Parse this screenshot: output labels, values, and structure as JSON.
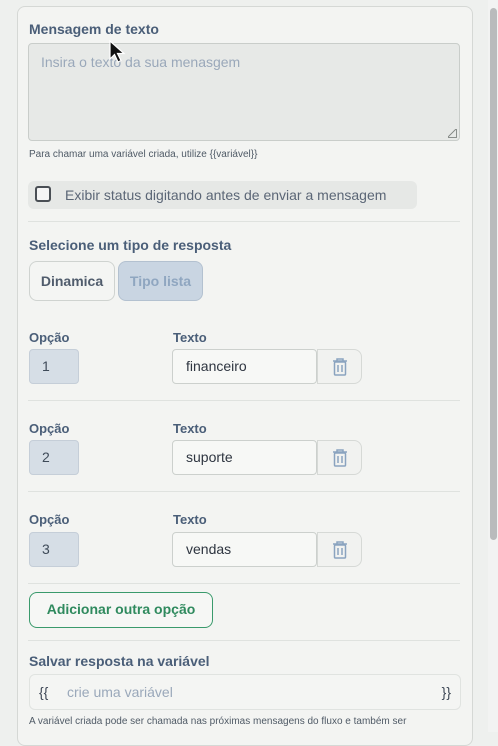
{
  "message_section": {
    "title": "Mensagem de texto",
    "placeholder": "Insira o texto da sua menasgem",
    "hint": "Para chamar uma variável criada, utilize {{variável}}"
  },
  "typing_status": {
    "label": "Exibir status digitando antes de enviar a mensagem",
    "checked": false
  },
  "response_type": {
    "title": "Selecione um tipo de resposta",
    "options": [
      "Dinamica",
      "Tipo lista"
    ],
    "selected": "Tipo lista"
  },
  "options": {
    "col_option": "Opção",
    "col_text": "Texto",
    "rows": [
      {
        "number": "1",
        "text": "financeiro"
      },
      {
        "number": "2",
        "text": "suporte"
      },
      {
        "number": "3",
        "text": "vendas"
      }
    ]
  },
  "add_option_label": "Adicionar outra opção",
  "save_variable": {
    "title": "Salvar resposta na variável",
    "left_brace": "{{",
    "right_brace": "}}",
    "placeholder": "crie uma variável",
    "note": "A variável criada pode ser chamada nas próximas mensagens do fluxo e também ser"
  },
  "colors": {
    "accent_green": "#2f8a5e",
    "label_blue": "#4a5e78",
    "selected_segment": "#c9d5e2"
  },
  "icons": {
    "delete": "trash-icon",
    "cursor": "mouse-pointer-icon"
  }
}
